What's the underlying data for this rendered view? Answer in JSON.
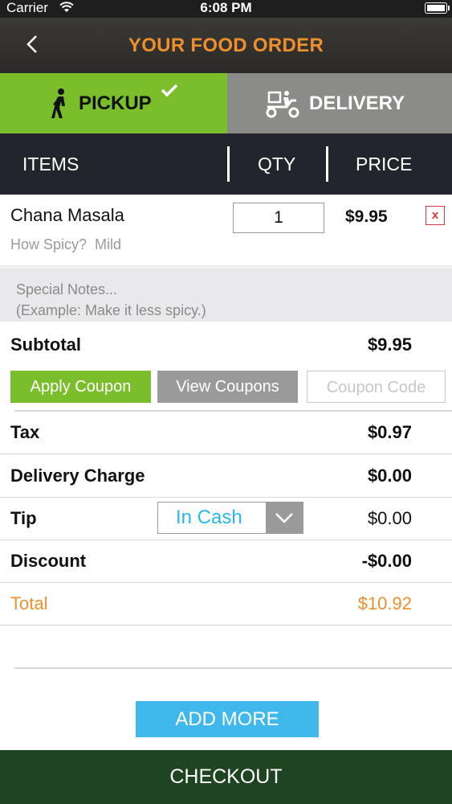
{
  "status_bar": {
    "carrier": "Carrier",
    "time": "6:08 PM"
  },
  "header": {
    "title": "YOUR FOOD ORDER"
  },
  "mode_tabs": {
    "pickup": "PICKUP",
    "delivery": "DELIVERY",
    "selected": "pickup"
  },
  "columns": {
    "items": "ITEMS",
    "qty": "QTY",
    "price": "PRICE"
  },
  "order_item": {
    "name": "Chana Masala",
    "spice_label": "How Spicy?",
    "spice_value": "Mild",
    "qty": "1",
    "price": "$9.95",
    "remove_symbol": "x"
  },
  "notes": {
    "line1": "Special Notes...",
    "line2": "(Example: Make it less spicy.)"
  },
  "summary": {
    "subtotal_label": "Subtotal",
    "subtotal_value": "$9.95",
    "tax_label": "Tax",
    "tax_value": "$0.97",
    "delivery_label": "Delivery Charge",
    "delivery_value": "$0.00",
    "tip_label": "Tip",
    "tip_method": "In Cash",
    "tip_value": "$0.00",
    "discount_label": "Discount",
    "discount_value": "-$0.00",
    "total_label": "Total",
    "total_value": "$10.92"
  },
  "coupons": {
    "apply": "Apply Coupon",
    "view": "View Coupons",
    "code_placeholder": "Coupon Code"
  },
  "actions": {
    "add_more": "ADD MORE",
    "checkout": "CHECKOUT"
  },
  "colors": {
    "accent_orange": "#ee8f2e",
    "pickup_green": "#7abf2b",
    "delivery_gray": "#8b8b89",
    "header_dark": "#22262c",
    "add_more_blue": "#41b8ec",
    "checkout_green": "#1f4421",
    "remove_red": "#d8383a"
  }
}
